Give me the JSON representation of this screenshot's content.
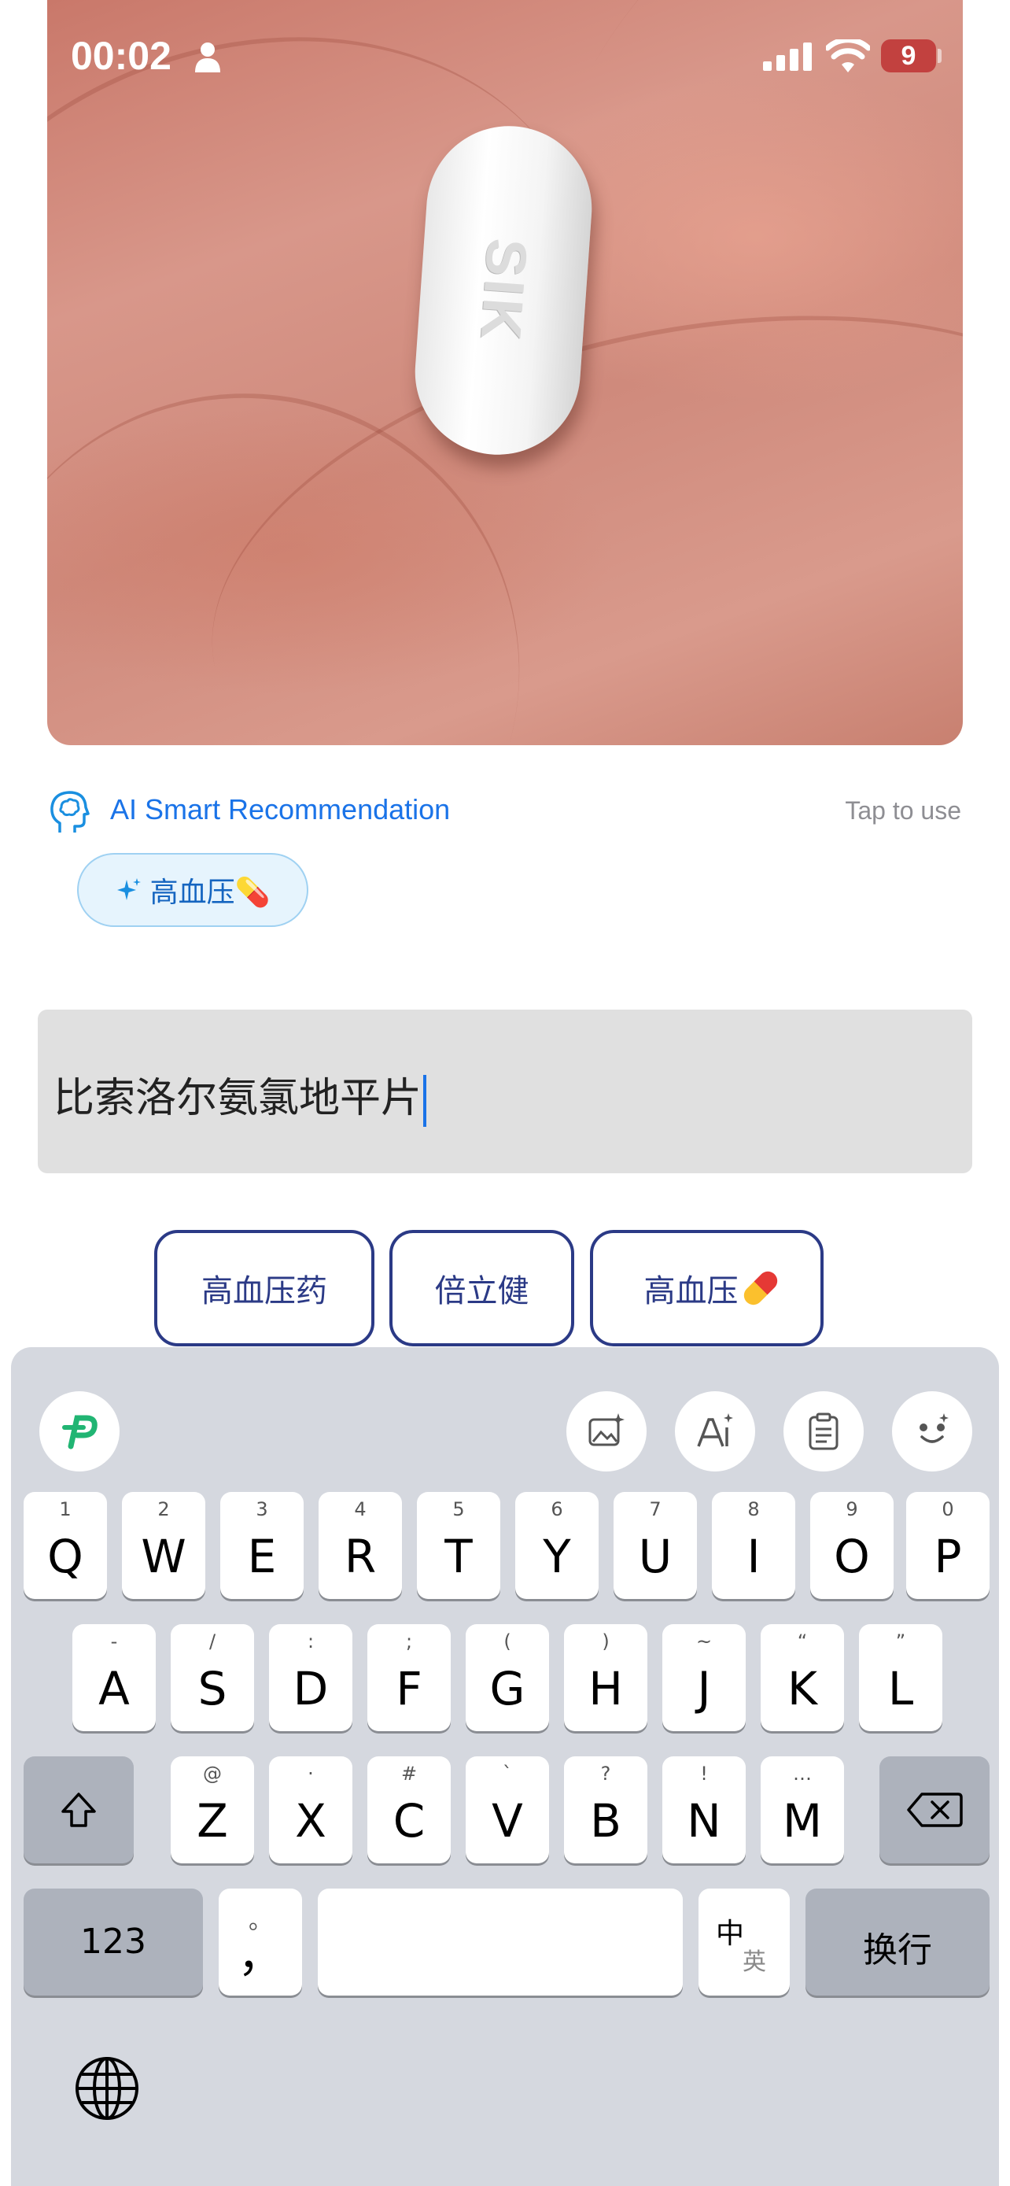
{
  "status_bar": {
    "time": "00:02",
    "battery": "9"
  },
  "photo": {
    "pill_imprint": "SIK"
  },
  "recommendation": {
    "title": "AI Smart Recommendation",
    "hint": "Tap to use",
    "chip": "高血压💊"
  },
  "input": {
    "value": "比索洛尔氨氯地平片"
  },
  "suggestions": [
    {
      "label": "高血压药"
    },
    {
      "label": "倍立健"
    },
    {
      "label": "高血压"
    }
  ],
  "keyboard": {
    "toolbar_icons": [
      "keyboard-logo-icon",
      "image-icon",
      "ai-writing-icon",
      "clipboard-icon",
      "emoji-icon"
    ],
    "row1": [
      {
        "k": "Q",
        "s": "1"
      },
      {
        "k": "W",
        "s": "2"
      },
      {
        "k": "E",
        "s": "3"
      },
      {
        "k": "R",
        "s": "4"
      },
      {
        "k": "T",
        "s": "5"
      },
      {
        "k": "Y",
        "s": "6"
      },
      {
        "k": "U",
        "s": "7"
      },
      {
        "k": "I",
        "s": "8"
      },
      {
        "k": "O",
        "s": "9"
      },
      {
        "k": "P",
        "s": "0"
      }
    ],
    "row2": [
      {
        "k": "A",
        "s": "-"
      },
      {
        "k": "S",
        "s": "/"
      },
      {
        "k": "D",
        "s": ":"
      },
      {
        "k": "F",
        "s": ";"
      },
      {
        "k": "G",
        "s": "("
      },
      {
        "k": "H",
        "s": ")"
      },
      {
        "k": "J",
        "s": "~"
      },
      {
        "k": "K",
        "s": "“"
      },
      {
        "k": "L",
        "s": "”"
      }
    ],
    "row3": [
      {
        "k": "Z",
        "s": "@"
      },
      {
        "k": "X",
        "s": "·"
      },
      {
        "k": "C",
        "s": "#"
      },
      {
        "k": "V",
        "s": "`"
      },
      {
        "k": "B",
        "s": "?"
      },
      {
        "k": "N",
        "s": "!"
      },
      {
        "k": "M",
        "s": "…"
      }
    ],
    "numbers_key": "123",
    "comma_key": "，",
    "comma_sub": "。",
    "lang_key_top": "中",
    "lang_key_bottom": "英",
    "return_key": "换行"
  }
}
